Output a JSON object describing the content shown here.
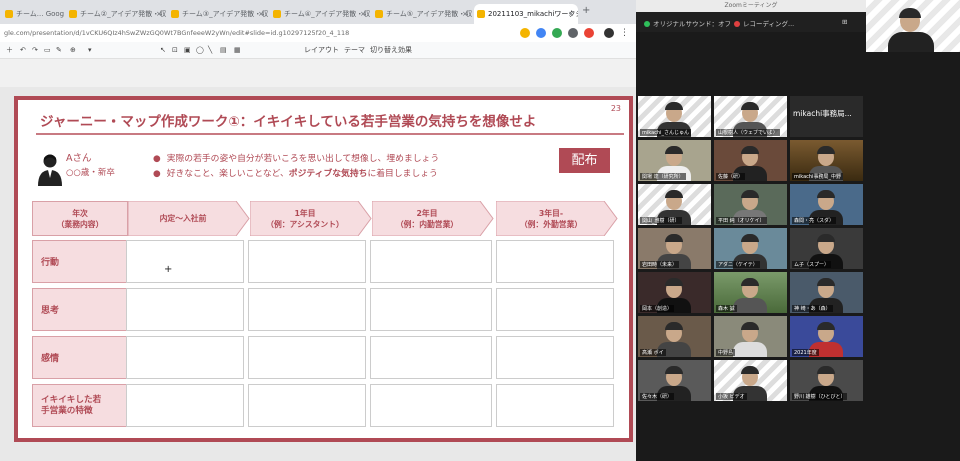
{
  "browser": {
    "tabs": [
      {
        "label": "チーム... Google ス",
        "active": false
      },
      {
        "label": "チーム②_アイデア発散・収束",
        "active": false
      },
      {
        "label": "チーム③_アイデア発散・収束",
        "active": false
      },
      {
        "label": "チーム④_アイデア発散・収束",
        "active": false
      },
      {
        "label": "チーム⑤_アイデア発散・収束",
        "active": false
      },
      {
        "label": "20211103_mikachiワークショ",
        "active": true
      }
    ],
    "new_tab": "+",
    "url": "gle.com/presentation/d/1vCKU6QIz4hSwZWzGQ0Wt7BGnfeeeW2yWn/edit#slide=id.g10297125f20_4_118",
    "toolbar_items": [
      "レイアウト",
      "テーマ",
      "切り替え効果"
    ]
  },
  "slide": {
    "number": "23",
    "title": "ジャーニー・マップ作成ワーク①：イキイキしている若手営業の気持ちを想像せよ",
    "persona_name": "Aさん",
    "persona_age": "○○歳・新卒",
    "bullet1": "実際の若手の姿や自分が若いころを思い出して想像し、埋めましょう",
    "bullet2_pre": "好きなこと、楽しいことなど、",
    "bullet2_bold": "ポジティブな気持ち",
    "bullet2_post": "に着目しましょう",
    "handout_label": "配布",
    "header_label_line1": "年次",
    "header_label_line2": "（業務内容）",
    "stages": [
      {
        "line1": "内定〜入社前",
        "line2": ""
      },
      {
        "line1": "1年目",
        "line2": "（例：アシスタント）"
      },
      {
        "line1": "2年目",
        "line2": "（例：内勤営業）"
      },
      {
        "line1": "3年目-",
        "line2": "（例：外勤営業）"
      }
    ],
    "rows": [
      {
        "line1": "行動",
        "line2": ""
      },
      {
        "line1": "思考",
        "line2": ""
      },
      {
        "line1": "感情",
        "line2": ""
      },
      {
        "line1": "イキイキした若",
        "line2": "手営業の特徴"
      }
    ],
    "cursor": "+"
  },
  "zoom": {
    "window_title": "Zoomミーティング",
    "original_sound": "オリジナルサウンド：オフ",
    "recording": "レコーディング...",
    "participants": [
      {
        "name": "mikachi_さんじゅん",
        "text": ""
      },
      {
        "name": "山根樹人（ウェブでいよ）",
        "text": ""
      },
      {
        "name": "",
        "text": "mikachi事務局..."
      },
      {
        "name": "関場 達（研究所）",
        "text": ""
      },
      {
        "name": "佐藤（研）",
        "text": ""
      },
      {
        "name": "mikachi事務局_中野",
        "text": ""
      },
      {
        "name": "関山_雅樹（研）",
        "text": ""
      },
      {
        "name": "平田 純（オリケイ）",
        "text": ""
      },
      {
        "name": "森間・亮（スダ）",
        "text": ""
      },
      {
        "name": "岩田時（未来）",
        "text": ""
      },
      {
        "name": "アダニ（ケイテ）",
        "text": ""
      },
      {
        "name": "ム子（スプー）",
        "text": ""
      },
      {
        "name": "岡本（創造）",
        "text": ""
      },
      {
        "name": "森木 誠",
        "text": ""
      },
      {
        "name": "神 崎・あ（森）",
        "text": ""
      },
      {
        "name": "高瀬 ポイ",
        "text": ""
      },
      {
        "name": "中野島",
        "text": ""
      },
      {
        "name": "2021年度",
        "text": ""
      },
      {
        "name": "佐々木（研）",
        "text": ""
      },
      {
        "name": "小坂 ビデオ",
        "text": ""
      },
      {
        "name": "野川 雄樹（ひとびと）",
        "text": ""
      }
    ]
  }
}
